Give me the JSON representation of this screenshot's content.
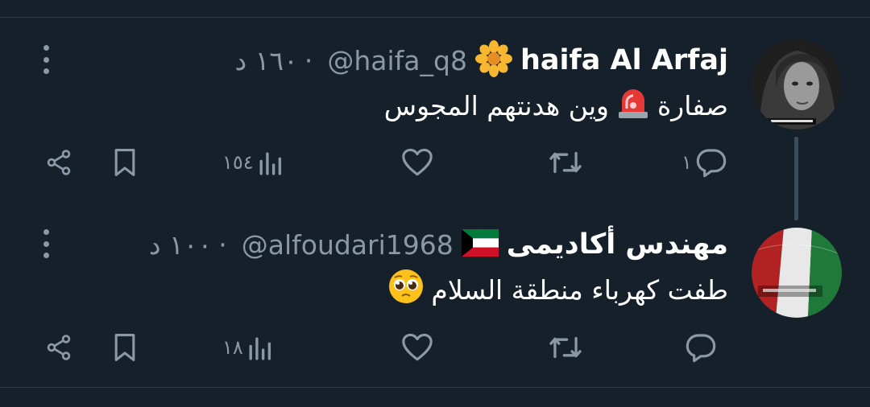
{
  "tweets": [
    {
      "name": "haifa Al Arfaj",
      "handle": "@haifa_q8",
      "time": "١٦٠ د",
      "separator": "·",
      "text": "صفارة",
      "text_after": "وين هدنتهم المجوس",
      "emoji_name": "siren-emoji",
      "name_emoji": "flower-emoji",
      "stats": {
        "replies": "١",
        "retweets": "",
        "likes": "",
        "views": "١٥٤"
      }
    },
    {
      "name": "مهندس أكاديمى",
      "handle": "@alfoudari1968",
      "time": "١٠٠ د",
      "separator": "·",
      "text": "طفت كهرباء منطقة السلام",
      "emoji_name": "pleading-face-emoji",
      "name_emoji": "kuwait-flag-emoji",
      "stats": {
        "replies": "",
        "retweets": "",
        "likes": "",
        "views": "١٨"
      }
    }
  ],
  "colors": {
    "background": "#15202b",
    "text": "#ffffff",
    "muted": "#8b98a5",
    "divider": "#2f3b47"
  }
}
